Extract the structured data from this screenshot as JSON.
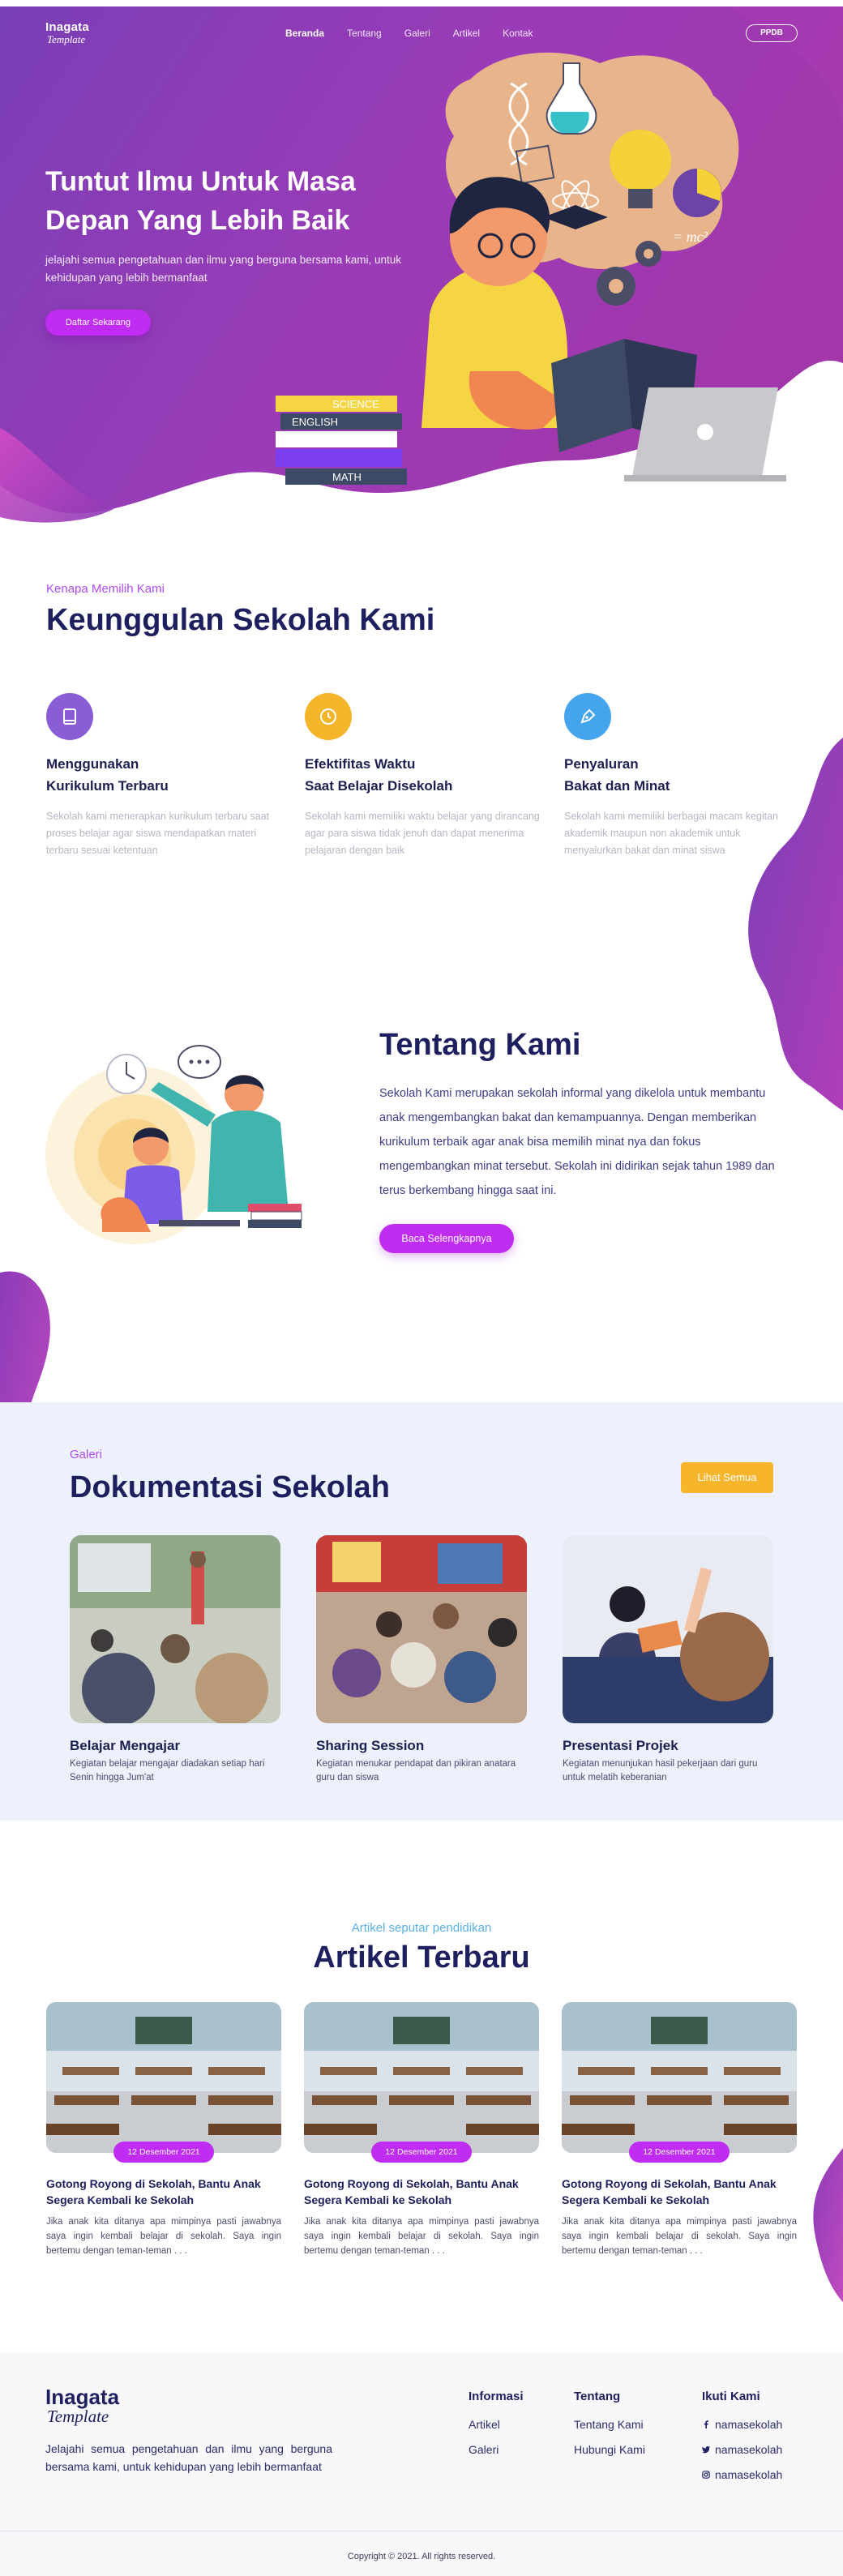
{
  "brand": {
    "name": "Inagata",
    "tagline": "Template"
  },
  "nav": {
    "items": [
      {
        "label": "Beranda",
        "active": true
      },
      {
        "label": "Tentang",
        "active": false
      },
      {
        "label": "Galeri",
        "active": false
      },
      {
        "label": "Artikel",
        "active": false
      },
      {
        "label": "Kontak",
        "active": false
      }
    ],
    "cta_label": "PPDB"
  },
  "hero": {
    "title": "Tuntut Ilmu Untuk Masa Depan Yang Lebih Baik",
    "description": "jelajahi semua pengetahuan dan ilmu yang berguna bersama kami, untuk kehidupan yang lebih bermanfaat",
    "cta_label": "Daftar Sekarang",
    "book_labels": [
      "SCIENCE",
      "ENGLISH",
      "MATH"
    ],
    "formula": "= mc²"
  },
  "why": {
    "eyebrow": "Kenapa Memilih Kami",
    "title": "Keunggulan Sekolah Kami",
    "features": [
      {
        "icon": "book-icon",
        "color": "#8a5cd6",
        "title_line1": "Menggunakan",
        "title_line2": "Kurikulum Terbaru",
        "text": "Sekolah kami menerapkan kurikulum terbaru saat proses belajar agar siswa mendapatkan materi terbaru sesuai ketentuan"
      },
      {
        "icon": "clock-icon",
        "color": "#f5b52b",
        "title_line1": "Efektifitas Waktu",
        "title_line2": "Saat Belajar Disekolah",
        "text": "Sekolah kami memiliki waktu belajar yang dirancang agar para siswa tidak jenuh dan dapat menerima pelajaran dengan baik"
      },
      {
        "icon": "pen-tool-icon",
        "color": "#45a4ee",
        "title_line1": "Penyaluran",
        "title_line2": "Bakat dan Minat",
        "text": "Sekolah kami memiliki berbagai macam kegitan akademik maupun non akademik untuk menyalurkan bakat dan minat siswa"
      }
    ]
  },
  "about": {
    "title": "Tentang Kami",
    "text": "Sekolah Kami merupakan sekolah informal yang dikelola untuk membantu anak mengembangkan bakat dan kemampuannya. Dengan memberikan kurikulum terbaik agar anak bisa memilih minat nya dan fokus mengembangkan minat tersebut. Sekolah ini didirikan sejak tahun 1989 dan terus berkembang hingga saat ini.",
    "cta_label": "Baca Selengkapnya"
  },
  "gallery": {
    "eyebrow": "Galeri",
    "title": "Dokumentasi Sekolah",
    "cta_label": "Lihat Semua",
    "items": [
      {
        "title": "Belajar Mengajar",
        "text": "Kegiatan belajar mengajar diadakan setiap hari Senin hingga Jum'at"
      },
      {
        "title": "Sharing Session",
        "text": "Kegiatan menukar pendapat dan pikiran anatara guru dan siswa"
      },
      {
        "title": "Presentasi Projek",
        "text": "Kegiatan menunjukan hasil pekerjaan dari guru untuk melatih keberanian"
      }
    ]
  },
  "articles": {
    "eyebrow": "Artikel seputar pendidikan",
    "title": "Artikel Terbaru",
    "items": [
      {
        "date": "12 Desember 2021",
        "title": "Gotong Royong di Sekolah, Bantu Anak Segera Kembali ke Sekolah",
        "excerpt": "Jika anak kita ditanya apa mimpinya pasti jawabnya saya ingin kembali belajar di sekolah. Saya ingin bertemu dengan teman-teman . . ."
      },
      {
        "date": "12 Desember 2021",
        "title": "Gotong Royong di Sekolah, Bantu Anak Segera Kembali ke Sekolah",
        "excerpt": "Jika anak kita ditanya apa mimpinya pasti jawabnya saya ingin kembali belajar di sekolah. Saya ingin bertemu dengan teman-teman . . ."
      },
      {
        "date": "12 Desember 2021",
        "title": "Gotong Royong di Sekolah, Bantu Anak Segera Kembali ke Sekolah",
        "excerpt": "Jika anak kita ditanya apa mimpinya pasti jawabnya saya ingin kembali belajar di sekolah. Saya ingin bertemu dengan teman-teman . . ."
      }
    ]
  },
  "footer": {
    "description": "Jelajahi semua pengetahuan dan ilmu yang berguna bersama kami, untuk kehidupan yang lebih bermanfaat",
    "columns": [
      {
        "title": "Informasi",
        "links": [
          "Artikel",
          "Galeri"
        ]
      },
      {
        "title": "Tentang",
        "links": [
          "Tentang Kami",
          "Hubungi Kami"
        ]
      }
    ],
    "social": {
      "title": "Ikuti Kami",
      "links": [
        {
          "icon": "facebook-icon",
          "label": "namasekolah"
        },
        {
          "icon": "twitter-icon",
          "label": "namasekolah"
        },
        {
          "icon": "instagram-icon",
          "label": "namasekolah"
        }
      ]
    },
    "copyright": "Copyright © 2021. All rights reserved."
  },
  "colors": {
    "primary_purple": "#c02cf2",
    "hero_gradient_start": "#7b3fb0",
    "hero_gradient_end": "#a436b0",
    "navy": "#1d1f5f",
    "gallery_bg": "#edf1fe",
    "accent_yellow": "#f7b52c",
    "accent_blue": "#45a4ee"
  }
}
